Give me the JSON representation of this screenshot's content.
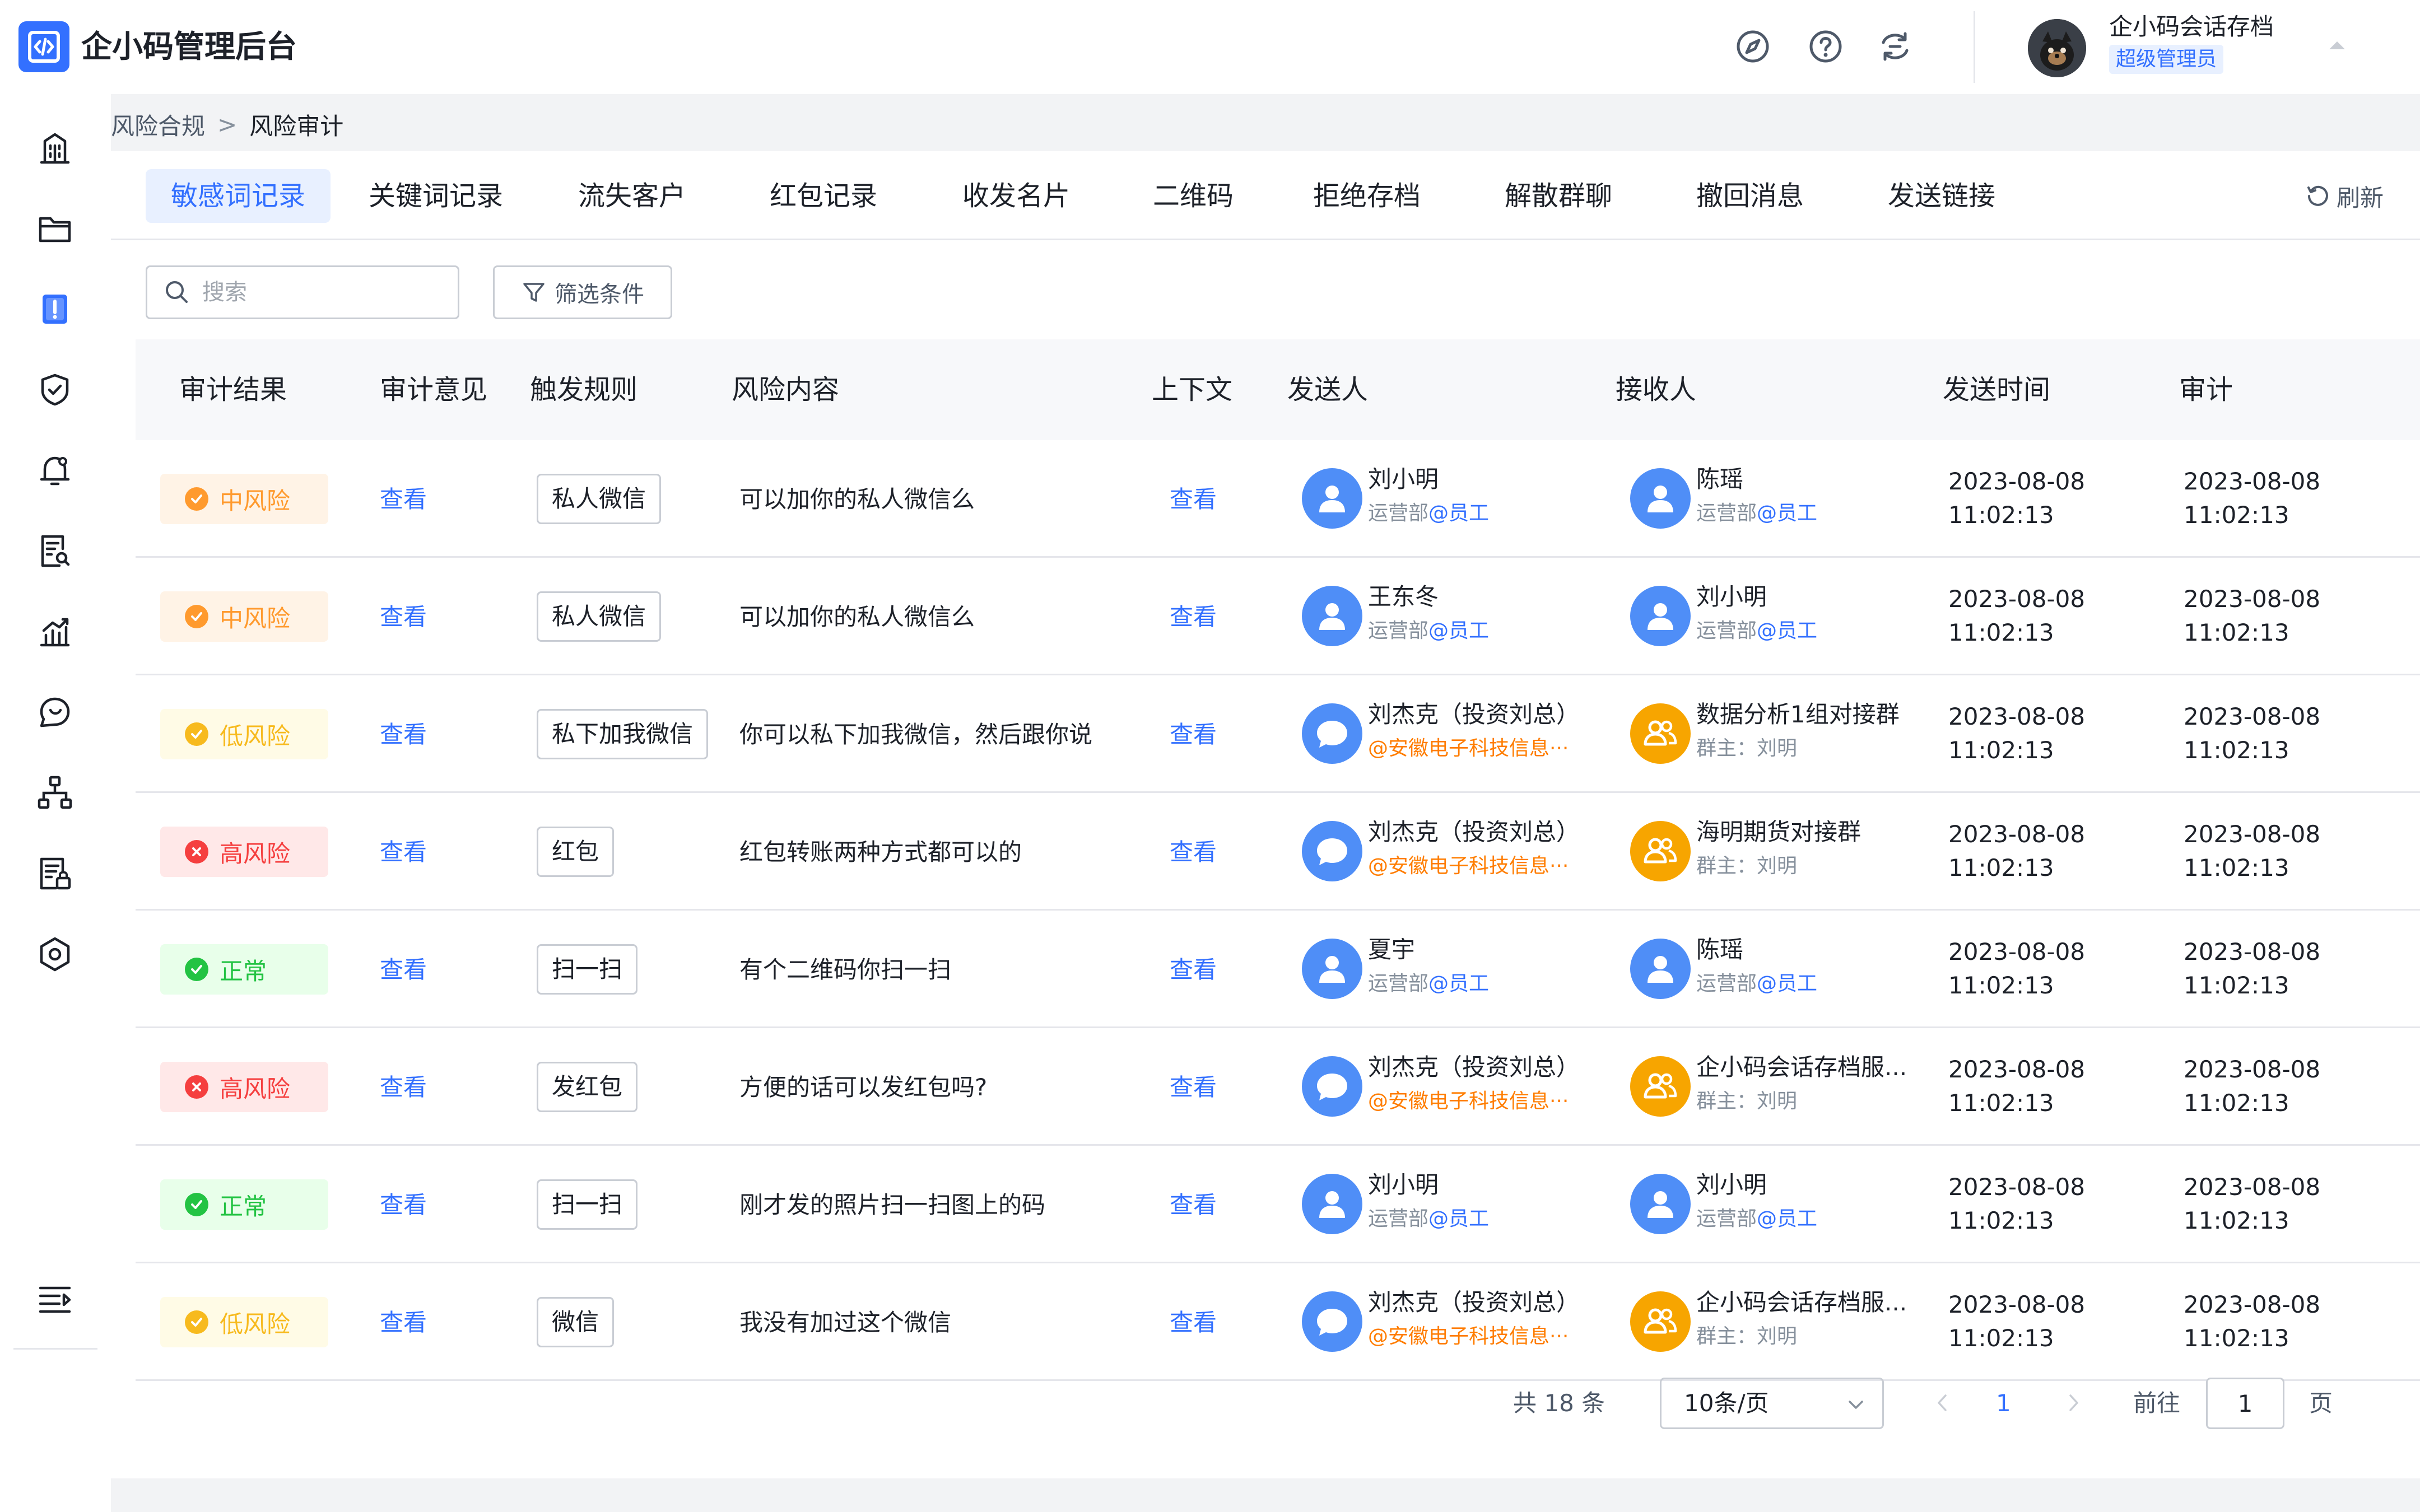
{
  "header": {
    "app_title": "企小码管理后台",
    "user_name": "企小码会话存档",
    "user_role": "超级管理员",
    "icons": [
      "compass-icon",
      "help-icon",
      "switch-icon"
    ]
  },
  "breadcrumb": {
    "parent": "风险合规",
    "separator": ">",
    "current": "风险审计"
  },
  "tabs": [
    {
      "label": "敏感词记录",
      "active": true
    },
    {
      "label": "关键词记录",
      "active": false
    },
    {
      "label": "流失客户",
      "active": false
    },
    {
      "label": "红包记录",
      "active": false
    },
    {
      "label": "收发名片",
      "active": false
    },
    {
      "label": "二维码",
      "active": false
    },
    {
      "label": "拒绝存档",
      "active": false
    },
    {
      "label": "解散群聊",
      "active": false
    },
    {
      "label": "撤回消息",
      "active": false
    },
    {
      "label": "发送链接",
      "active": false
    }
  ],
  "refresh_label": "刷新",
  "search": {
    "placeholder": "搜索",
    "value": ""
  },
  "filter_label": "筛选条件",
  "columns": [
    "审计结果",
    "审计意见",
    "触发规则",
    "风险内容",
    "上下文",
    "发送人",
    "接收人",
    "发送时间",
    "审计"
  ],
  "colors": {
    "primary": "#3370ff",
    "medium_risk_bg": "#fff3e6",
    "medium_risk_fg": "#ff9a2e",
    "low_risk_bg": "#fffbe6",
    "low_risk_fg": "#f7ba1e",
    "high_risk_bg": "#ffe8e8",
    "high_risk_fg": "#f53f3f",
    "normal_bg": "#e8ffea",
    "normal_fg": "#23c343",
    "group_avatar": "#f7a500",
    "person_avatar": "#4f8ef7"
  },
  "rows": [
    {
      "risk": "中风险",
      "level": "medium",
      "opinion": "查看",
      "rule": "私人微信",
      "content": "可以加你的私人微信么",
      "context": "查看",
      "sender": {
        "name": "刘小明",
        "dept": "运营部",
        "tag": "@员工",
        "type": "person"
      },
      "receiver": {
        "name": "陈瑶",
        "dept": "运营部",
        "tag": "@员工",
        "type": "person"
      },
      "send_date": "2023-08-08",
      "send_time": "11:02:13",
      "audit_date": "2023-08-08",
      "audit_time": "11:02:13"
    },
    {
      "risk": "中风险",
      "level": "medium",
      "opinion": "查看",
      "rule": "私人微信",
      "content": "可以加你的私人微信么",
      "context": "查看",
      "sender": {
        "name": "王东冬",
        "dept": "运营部",
        "tag": "@员工",
        "type": "person"
      },
      "receiver": {
        "name": "刘小明",
        "dept": "运营部",
        "tag": "@员工",
        "type": "person"
      },
      "send_date": "2023-08-08",
      "send_time": "11:02:13",
      "audit_date": "2023-08-08",
      "audit_time": "11:02:13"
    },
    {
      "risk": "低风险",
      "level": "low",
      "opinion": "查看",
      "rule": "私下加我微信",
      "content": "你可以私下加我微信，然后跟你说",
      "context": "查看",
      "sender": {
        "name": "刘杰克（投资刘总）",
        "dept": "",
        "tag": "@安徽电子科技信息···",
        "type": "external"
      },
      "receiver": {
        "name": "数据分析1组对接群",
        "dept": "群主：刘明",
        "tag": "",
        "type": "group"
      },
      "send_date": "2023-08-08",
      "send_time": "11:02:13",
      "audit_date": "2023-08-08",
      "audit_time": "11:02:13"
    },
    {
      "risk": "高风险",
      "level": "high",
      "opinion": "查看",
      "rule": "红包",
      "content": "红包转账两种方式都可以的",
      "context": "查看",
      "sender": {
        "name": "刘杰克（投资刘总）",
        "dept": "",
        "tag": "@安徽电子科技信息···",
        "type": "external"
      },
      "receiver": {
        "name": "海明期货对接群",
        "dept": "群主：刘明",
        "tag": "",
        "type": "group"
      },
      "send_date": "2023-08-08",
      "send_time": "11:02:13",
      "audit_date": "2023-08-08",
      "audit_time": "11:02:13"
    },
    {
      "risk": "正常",
      "level": "normal",
      "opinion": "查看",
      "rule": "扫一扫",
      "content": "有个二维码你扫一扫",
      "context": "查看",
      "sender": {
        "name": "夏宇",
        "dept": "运营部",
        "tag": "@员工",
        "type": "person"
      },
      "receiver": {
        "name": "陈瑶",
        "dept": "运营部",
        "tag": "@员工",
        "type": "person"
      },
      "send_date": "2023-08-08",
      "send_time": "11:02:13",
      "audit_date": "2023-08-08",
      "audit_time": "11:02:13"
    },
    {
      "risk": "高风险",
      "level": "high",
      "opinion": "查看",
      "rule": "发红包",
      "content": "方便的话可以发红包吗?",
      "context": "查看",
      "sender": {
        "name": "刘杰克（投资刘总）",
        "dept": "",
        "tag": "@安徽电子科技信息···",
        "type": "external"
      },
      "receiver": {
        "name": "企小码会话存档服...",
        "dept": "群主：刘明",
        "tag": "",
        "type": "group"
      },
      "send_date": "2023-08-08",
      "send_time": "11:02:13",
      "audit_date": "2023-08-08",
      "audit_time": "11:02:13"
    },
    {
      "risk": "正常",
      "level": "normal",
      "opinion": "查看",
      "rule": "扫一扫",
      "content": "刚才发的照片扫一扫图上的码",
      "context": "查看",
      "sender": {
        "name": "刘小明",
        "dept": "运营部",
        "tag": "@员工",
        "type": "person"
      },
      "receiver": {
        "name": "刘小明",
        "dept": "运营部",
        "tag": "@员工",
        "type": "person"
      },
      "send_date": "2023-08-08",
      "send_time": "11:02:13",
      "audit_date": "2023-08-08",
      "audit_time": "11:02:13"
    },
    {
      "risk": "低风险",
      "level": "low",
      "opinion": "查看",
      "rule": "微信",
      "content": "我没有加过这个微信",
      "context": "查看",
      "sender": {
        "name": "刘杰克（投资刘总）",
        "dept": "",
        "tag": "@安徽电子科技信息···",
        "type": "external"
      },
      "receiver": {
        "name": "企小码会话存档服...",
        "dept": "群主：刘明",
        "tag": "",
        "type": "group"
      },
      "send_date": "2023-08-08",
      "send_time": "11:02:13",
      "audit_date": "2023-08-08",
      "audit_time": "11:02:13"
    }
  ],
  "pagination": {
    "total_text": "共 18 条",
    "page_size": "10条/页",
    "current_page": "1",
    "goto_label": "前往",
    "goto_value": "1",
    "page_label": "页"
  },
  "sidebar": [
    "building-icon",
    "folder-icon",
    "alert-icon",
    "shield-check-icon",
    "bell-icon",
    "document-search-icon",
    "chart-icon",
    "chat-icon",
    "org-tree-icon",
    "document-lock-icon",
    "settings-icon",
    "menu-toggle-icon"
  ]
}
